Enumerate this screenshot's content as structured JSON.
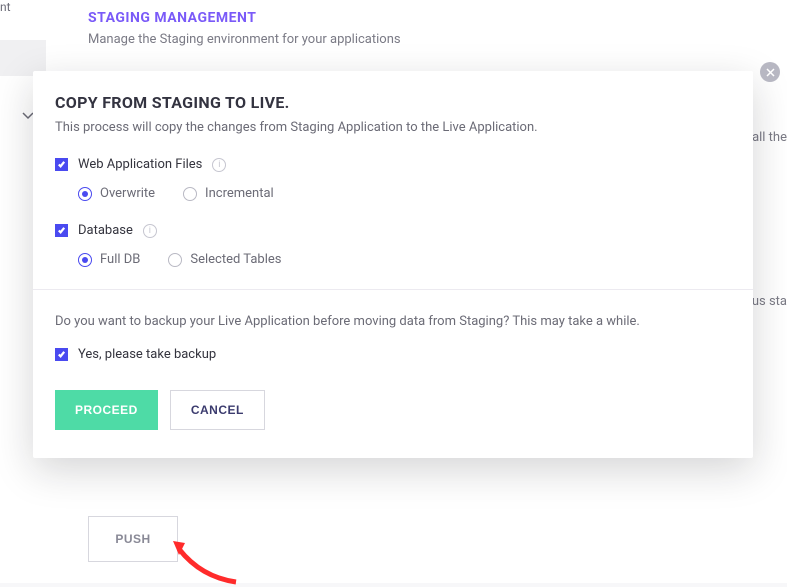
{
  "side": {
    "fragment": "nt"
  },
  "page": {
    "title": "STAGING MANAGEMENT",
    "subtitle": "Manage the Staging environment for your applications",
    "overflow1": "all the",
    "overflow2": "us sta",
    "push": "PUSH"
  },
  "modal": {
    "title": "COPY FROM STAGING TO LIVE.",
    "desc": "This process will copy the changes from Staging Application to the Live Application.",
    "opt1": {
      "label": "Web Application Files",
      "r1": "Overwrite",
      "r2": "Incremental"
    },
    "opt2": {
      "label": "Database",
      "r1": "Full DB",
      "r2": "Selected Tables"
    },
    "backupQuestion": "Do you want to backup your Live Application before moving data from Staging? This may take a while.",
    "backupLabel": "Yes, please take backup",
    "proceed": "PROCEED",
    "cancel": "CANCEL"
  }
}
